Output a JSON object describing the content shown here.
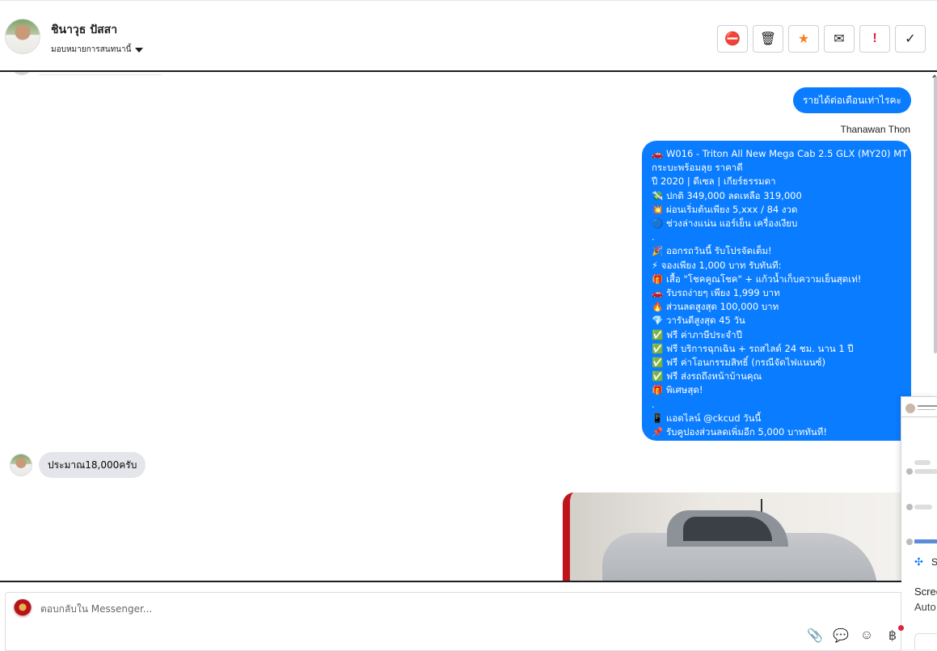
{
  "header": {
    "contact_name": "ชินาวุธ ปัสสา",
    "assign_label": "มอบหมายการสนทนานี้",
    "actions": [
      {
        "name": "spam",
        "glyph": "⛔"
      },
      {
        "name": "trash",
        "glyph": "🗑"
      },
      {
        "name": "star",
        "glyph": "★"
      },
      {
        "name": "mark-unread",
        "glyph": "✉"
      },
      {
        "name": "follow-up",
        "glyph": "!"
      },
      {
        "name": "done",
        "glyph": "✓"
      }
    ]
  },
  "messages": {
    "outgoing_short": "รายได้ต่อเดือนเท่าไรคะ",
    "sender_name": "Thanawan Thon",
    "outgoing_long": [
      "🚗 W016 - Triton All New Mega Cab 2.5 GLX (MY20) MT",
      "กระบะพร้อมลุย ราคาดี",
      "ปี 2020 | ดีเซล | เกียร์ธรรมดา",
      "💸 ปกติ 349,000 ลดเหลือ 319,000",
      "💥 ผ่อนเริ่มต้นเพียง 5,xxx / 84 งวด",
      "🔵 ช่วงล่างแน่น แอร์เย็น เครื่องเงียบ",
      ".",
      "🎉 ออกรถวันนี้ รับโปรจัดเต็ม!",
      "⚡ จองเพียง 1,000 บาท รับทันที:",
      "🎁 เสื้อ \"โชคคูณโชค\" + แก้วน้ำเก็บความเย็นสุดเท่!",
      "🚗 รับรถง่ายๆ เพียง 1,999 บาท",
      "🔥 ส่วนลดสูงสุด 100,000 บาท",
      "💎 วารันตีสูงสุด 45 วัน",
      "✅ ฟรี ค่าภาษีประจำปี",
      "✅ ฟรี บริการฉุกเฉิน + รถสไลด์ 24 ชม. นาน 1 ปี",
      "✅ ฟรี ค่าโอนกรรมสิทธิ์ (กรณีจัดไฟแนนซ์)",
      "✅ ฟรี ส่งรถถึงหน้าบ้านคุณ",
      "🎁 พิเศษสุด!",
      ".",
      "📱 แอดไลน์ @ckcud วันนี้",
      "📌 รับคูปองส่วนลดเพิ่มอีก 5,000 บาททันที!"
    ],
    "incoming": "ประมาณ18,000ครับ"
  },
  "composer": {
    "placeholder": "ตอบกลับใน Messenger..."
  },
  "side_widget": {
    "letter": "S",
    "line1": "Scree",
    "line2": "Auto"
  },
  "colors": {
    "accent": "#0a7cff",
    "incoming_bubble": "#e4e6eb",
    "star": "#f5821f",
    "alert": "#e41e3f"
  }
}
